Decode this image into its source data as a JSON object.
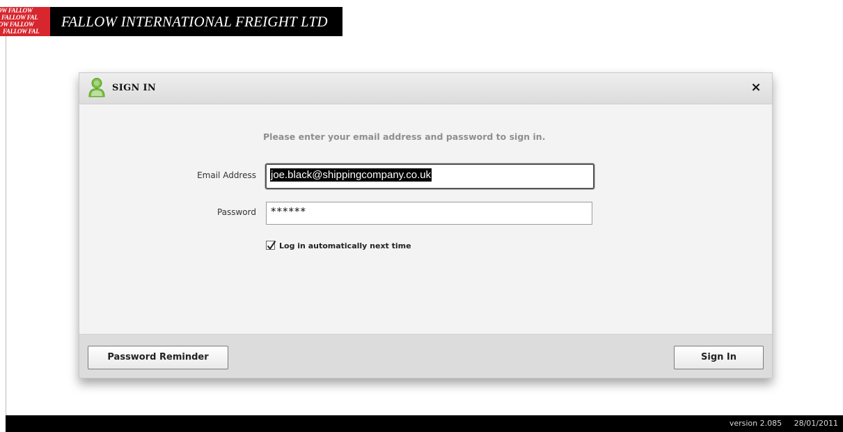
{
  "header": {
    "logo_text": [
      "OW FALLOW",
      "FALLOW FAL",
      "OW FALLOW",
      "FALLOW FAL"
    ],
    "company_name": "FALLOW INTERNATIONAL FREIGHT LTD"
  },
  "dialog": {
    "title": "SIGN IN",
    "close_label": "×",
    "instructions": "Please enter your email address and password to sign in.",
    "email": {
      "label": "Email Address",
      "value": "joe.black@shippingcompany.co.uk"
    },
    "password": {
      "label": "Password",
      "value": "******"
    },
    "remember": {
      "label": "Log in automatically next time",
      "checked": true
    },
    "buttons": {
      "reminder": "Password Reminder",
      "sign_in": "Sign In"
    }
  },
  "footer": {
    "version": "version 2.085",
    "date": "28/01/2011"
  },
  "icons": {
    "user": "user-icon",
    "close": "close-icon",
    "check": "checkmark-icon"
  },
  "colors": {
    "brand_red": "#d7262e",
    "user_icon_green": "#7ac142",
    "header_bg": "#000000"
  }
}
